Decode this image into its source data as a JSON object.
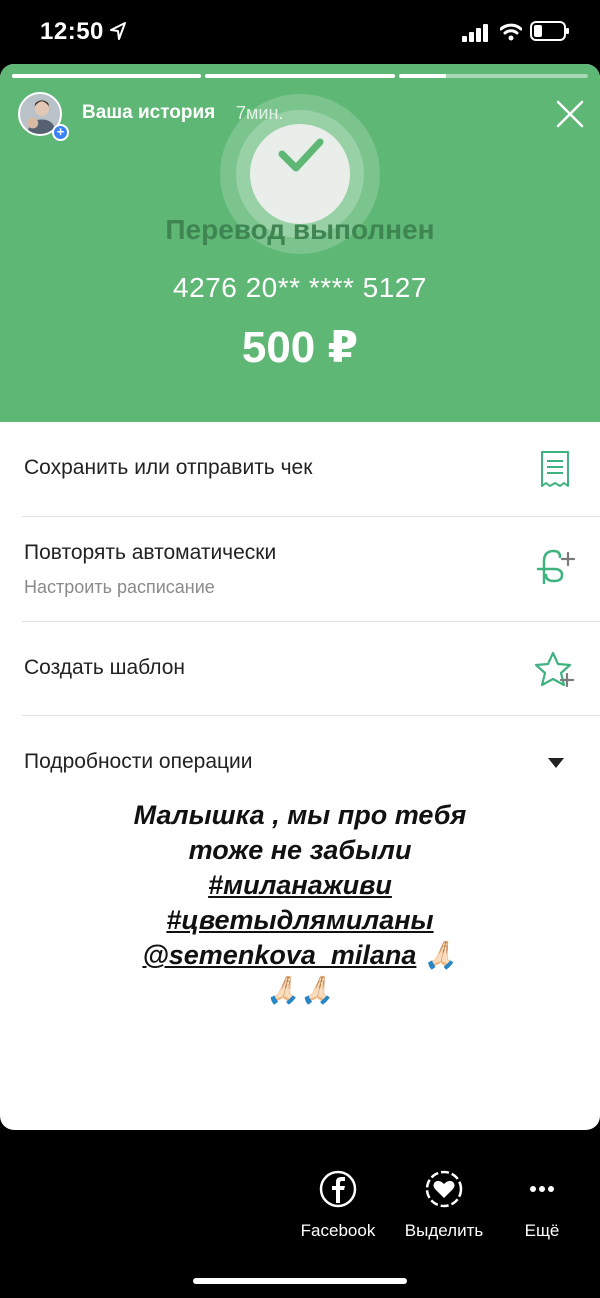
{
  "status_bar": {
    "time": "12:50",
    "icons": [
      "location-arrow-icon",
      "signal-icon",
      "wifi-icon",
      "battery-icon"
    ]
  },
  "story": {
    "user_label": "Ваша история",
    "time_ago": "7мин.",
    "progress": [
      1.0,
      1.0,
      0.25
    ]
  },
  "transfer": {
    "title": "Перевод выполнен",
    "card_number": "4276 20** **** 5127",
    "amount": "500 ₽"
  },
  "options": {
    "receipt_label": "Сохранить или отправить чек",
    "repeat_label": "Повторять автоматически",
    "repeat_sub": "Настроить расписание",
    "template_label": "Создать шаблон",
    "details_label": "Подробности операции"
  },
  "caption": {
    "line1": "Малышка , мы про тебя",
    "line2": "тоже не забыли",
    "line3": "#миланаживи",
    "line4": "#цветыдлямиланы",
    "mention": "@semenkova_milana",
    "emoji_inline": "🙏🏻",
    "emoji_line": "🙏🏻🙏🏻"
  },
  "bottom_bar": {
    "facebook": "Facebook",
    "highlight": "Выделить",
    "more": "Ещё"
  },
  "colors": {
    "green_header": "#5fb775",
    "title_green": "#3e8551",
    "icon_green": "#3fb37f"
  }
}
